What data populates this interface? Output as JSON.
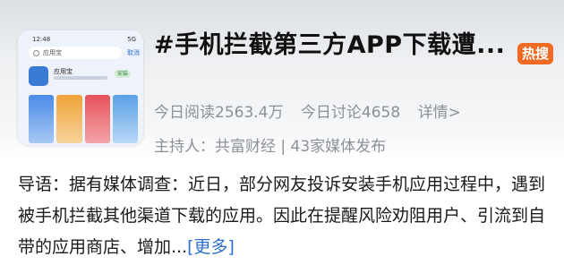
{
  "topic": {
    "title": "#手机拦截第三方APP下载遭...",
    "badge": "热搜",
    "stats": {
      "reads": "今日阅读2563.4万",
      "discussions": "今日讨论4658",
      "details": "详情>"
    },
    "host": "主持人：共富财经 | 43家媒体发布",
    "intro": "导语：据有媒体调查：近日，部分网友投诉安装手机应用过程中，遇到被手机拦截其他渠道下载的应用。因此在提醒风险劝阻用户、引流到自带的应用商店、增加...",
    "more_label": "[更多]"
  },
  "thumbnail": {
    "status_left": "12:48",
    "status_right": "5G",
    "search_text": "应用宝",
    "cancel_label": "取消",
    "app_name": "应用宝",
    "app_button": "安装"
  },
  "colors": {
    "badge": "#f06a23",
    "link": "#2f6fd1",
    "meta": "#8c9099"
  }
}
